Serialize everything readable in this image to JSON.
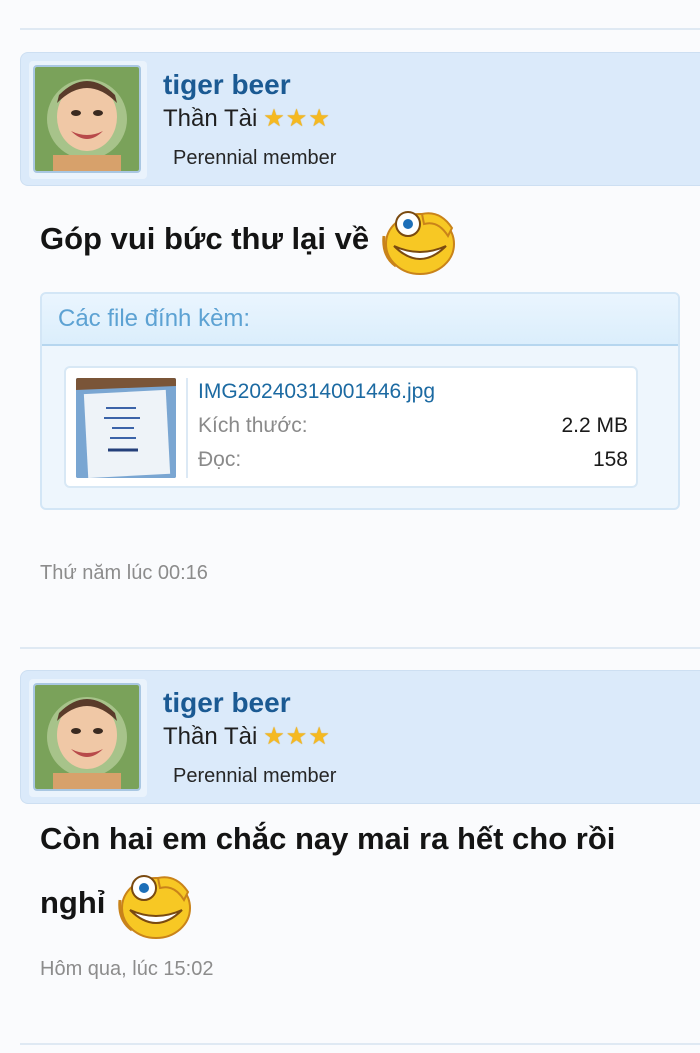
{
  "posts": [
    {
      "username": "tiger beer",
      "rank": "Thần Tài",
      "member_title": "Perennial member",
      "message": "Góp vui bức thư lại về",
      "attachments_title": "Các file đính kèm:",
      "file": {
        "name": "IMG20240314001446.jpg",
        "size_label": "Kích thước:",
        "size_value": "2.2 MB",
        "reads_label": "Đọc:",
        "reads_value": "158"
      },
      "date": "Thứ năm lúc 00:16"
    },
    {
      "username": "tiger beer",
      "rank": "Thần Tài",
      "member_title": "Perennial member",
      "message_line1": "Còn hai em chắc nay mai ra hết cho rồi",
      "message_line2": "nghỉ",
      "date": "Hôm qua, lúc 15:02"
    }
  ],
  "rank_stars": 3,
  "colors": {
    "username": "#1b5a93",
    "accent": "#dbeafa",
    "star": "#f5b921"
  }
}
